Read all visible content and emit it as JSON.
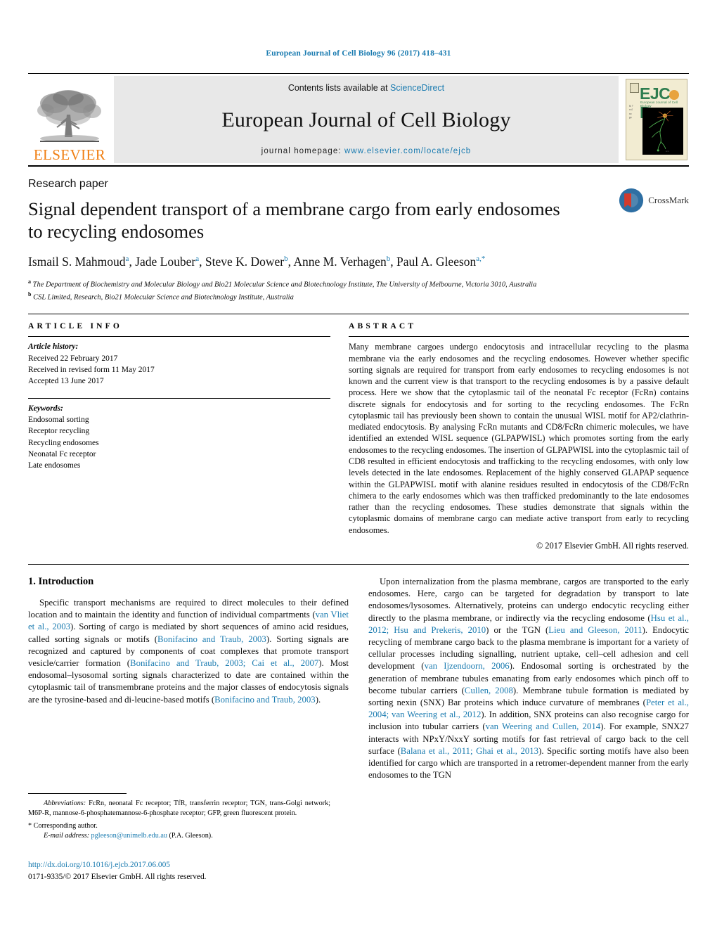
{
  "running_head": "European Journal of Cell Biology 96 (2017) 418–431",
  "masthead": {
    "publisher_name": "ELSEVIER",
    "contents_prefix": "Contents lists available at ",
    "contents_link": "ScienceDirect",
    "journal_title": "European Journal of Cell Biology",
    "homepage_prefix": "journal homepage: ",
    "homepage_url": "www.elsevier.com/locate/ejcb",
    "cover_title": "EJCB",
    "cover_subtitle": "European Journal of Cell Biology"
  },
  "article": {
    "kind": "Research paper",
    "title": "Signal dependent transport of a membrane cargo from early endosomes to recycling endosomes",
    "authors_line1": "Ismail S. Mahmoud",
    "authors": [
      {
        "name": "Ismail S. Mahmoud",
        "sup": "a",
        "sep": ", "
      },
      {
        "name": "Jade Louber",
        "sup": "a",
        "sep": ", "
      },
      {
        "name": "Steve K. Dower",
        "sup": "b",
        "sep": ", "
      },
      {
        "name": "Anne M. Verhagen",
        "sup": "b",
        "sep": ", "
      },
      {
        "name": "Paul A. Gleeson",
        "sup": "a,*",
        "sep": ""
      }
    ],
    "affiliations": [
      {
        "sup": "a",
        "text": "The Department of Biochemistry and Molecular Biology and Bio21 Molecular Science and Biotechnology Institute, The University of Melbourne, Victoria 3010, Australia"
      },
      {
        "sup": "b",
        "text": "CSL Limited, Research, Bio21 Molecular Science and Biotechnology Institute, Australia"
      }
    ],
    "crossmark_label": "CrossMark"
  },
  "article_info": {
    "heading": "ARTICLE INFO",
    "history_label": "Article history:",
    "history": [
      "Received 22 February 2017",
      "Received in revised form 11 May 2017",
      "Accepted 13 June 2017"
    ],
    "keywords_label": "Keywords:",
    "keywords": [
      "Endosomal sorting",
      "Receptor recycling",
      "Recycling endosomes",
      "Neonatal Fc receptor",
      "Late endosomes"
    ]
  },
  "abstract": {
    "heading": "ABSTRACT",
    "text": "Many membrane cargoes undergo endocytosis and intracellular recycling to the plasma membrane via the early endosomes and the recycling endosomes. However whether specific sorting signals are required for transport from early endosomes to recycling endosomes is not known and the current view is that transport to the recycling endosomes is by a passive default process. Here we show that the cytoplasmic tail of the neonatal Fc receptor (FcRn) contains discrete signals for endocytosis and for sorting to the recycling endosomes. The FcRn cytoplasmic tail has previously been shown to contain the unusual WISL motif for AP2/clathrin-mediated endocytosis. By analysing FcRn mutants and CD8/FcRn chimeric molecules, we have identified an extended WISL sequence (GLPAPWISL) which promotes sorting from the early endosomes to the recycling endosomes. The insertion of GLPAPWISL into the cytoplasmic tail of CD8 resulted in efficient endocytosis and trafficking to the recycling endosomes, with only low levels detected in the late endosomes. Replacement of the highly conserved GLAPAP sequence within the GLPAPWISL motif with alanine residues resulted in endocytosis of the CD8/FcRn chimera to the early endosomes which was then trafficked predominantly to the late endosomes rather than the recycling endosomes. These studies demonstrate that signals within the cytoplasmic domains of membrane cargo can mediate active transport from early to recycling endosomes.",
    "copyright": "© 2017 Elsevier GmbH. All rights reserved."
  },
  "introduction": {
    "heading": "1.  Introduction",
    "left_paragraph_parts": [
      {
        "t": "Specific transport mechanisms are required to direct molecules to their defined location and to maintain the identity and function of individual compartments (",
        "link": false
      },
      {
        "t": "van Vliet et al., 2003",
        "link": true
      },
      {
        "t": "). Sorting of cargo is mediated by short sequences of amino acid residues, called sorting signals or motifs (",
        "link": false
      },
      {
        "t": "Bonifacino and Traub, 2003",
        "link": true
      },
      {
        "t": "). Sorting signals are recognized and captured by components of coat complexes that promote transport vesicle/carrier formation (",
        "link": false
      },
      {
        "t": "Bonifacino and Traub, 2003; Cai et al., 2007",
        "link": true
      },
      {
        "t": "). Most endosomal–lysosomal sorting signals characterized to date are contained within the cytoplasmic tail of transmembrane proteins and the major classes of endocytosis signals are the tyrosine-based and di-leucine-based motifs (",
        "link": false
      },
      {
        "t": "Bonifacino and Traub, 2003",
        "link": true
      },
      {
        "t": ").",
        "link": false
      }
    ],
    "right_paragraph_parts": [
      {
        "t": "Upon internalization from the plasma membrane, cargos are transported to the early endosomes. Here, cargo can be targeted for degradation by transport to late endosomes/lysosomes. Alternatively, proteins can undergo endocytic recycling either directly to the plasma membrane, or indirectly via the recycling endosome (",
        "link": false
      },
      {
        "t": "Hsu et al., 2012; Hsu and Prekeris, 2010",
        "link": true
      },
      {
        "t": ") or the TGN (",
        "link": false
      },
      {
        "t": "Lieu and Gleeson, 2011",
        "link": true
      },
      {
        "t": "). Endocytic recycling of membrane cargo back to the plasma membrane is important for a variety of cellular processes including signalling, nutrient uptake, cell–cell adhesion and cell development (",
        "link": false
      },
      {
        "t": "van Ijzendoorn, 2006",
        "link": true
      },
      {
        "t": "). Endosomal sorting is orchestrated by the generation of membrane tubules emanating from early endosomes which pinch off to become tubular carriers (",
        "link": false
      },
      {
        "t": "Cullen, 2008",
        "link": true
      },
      {
        "t": "). Membrane tubule formation is mediated by sorting nexin (SNX) Bar proteins which induce curvature of membranes (",
        "link": false
      },
      {
        "t": "Peter et al., 2004; van Weering et al., 2012",
        "link": true
      },
      {
        "t": "). In addition, SNX proteins can also recognise cargo for inclusion into tubular carriers (",
        "link": false
      },
      {
        "t": "van Weering and Cullen, 2014",
        "link": true
      },
      {
        "t": "). For example, SNX27 interacts with NPxY/NxxY sorting motifs for fast retrieval of cargo back to the cell surface (",
        "link": false
      },
      {
        "t": "Balana et al., 2011; Ghai et al., 2013",
        "link": true
      },
      {
        "t": "). Specific sorting motifs have also been identified for cargo which are transported in a retromer-dependent manner from the early endosomes to the TGN",
        "link": false
      }
    ]
  },
  "footnotes": {
    "abbreviations_label": "Abbreviations:",
    "abbreviations_text": " FcRn, neonatal Fc receptor; TfR, transferrin receptor; TGN, trans-Golgi network; M6P-R, mannose-6-phosphatemannose-6-phosphate receptor; GFP, green fluorescent protein.",
    "corresponding": "* Corresponding author.",
    "email_label": "E-mail address:",
    "email": "pgleeson@unimelb.edu.au",
    "email_suffix": " (P.A. Gleeson).",
    "doi": "http://dx.doi.org/10.1016/j.ejcb.2017.06.005",
    "issn_line": "0171-9335/© 2017 Elsevier GmbH. All rights reserved."
  },
  "colors": {
    "link": "#1a7bb0",
    "elsevier_orange": "#f07f13",
    "masthead_gray": "#e8e8e8"
  }
}
